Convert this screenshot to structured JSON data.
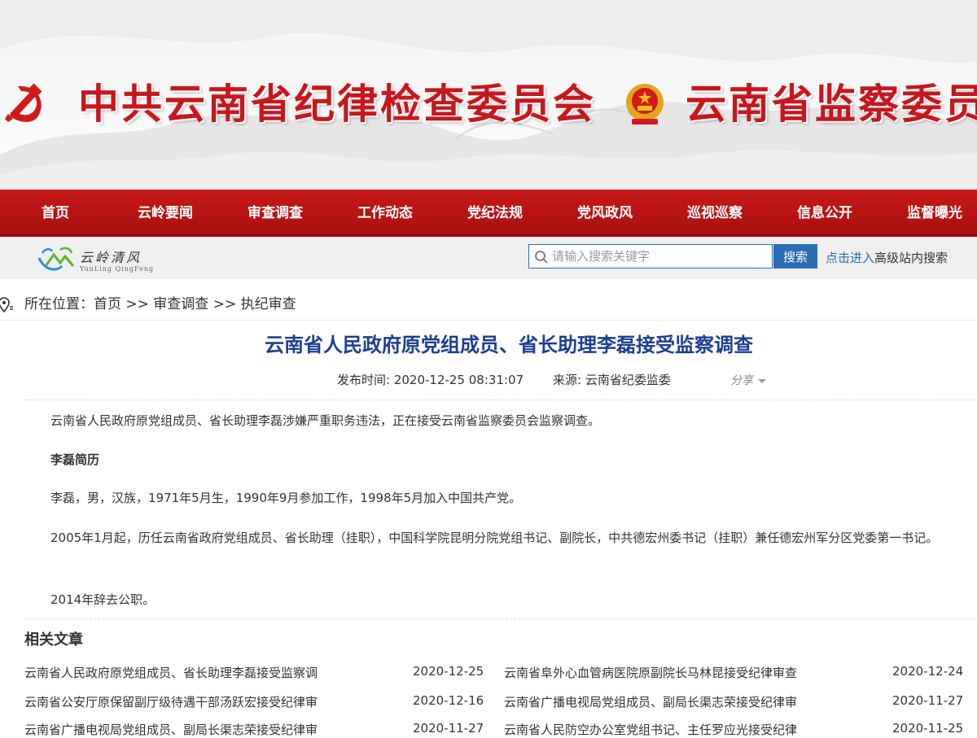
{
  "banner": {
    "title_left": "中共云南省纪律检查委员会",
    "title_right": "云南省监察委员会"
  },
  "nav": {
    "items": [
      {
        "label": "首页"
      },
      {
        "label": "云岭要闻"
      },
      {
        "label": "审查调查"
      },
      {
        "label": "工作动态"
      },
      {
        "label": "党纪法规"
      },
      {
        "label": "党风政风"
      },
      {
        "label": "巡视巡察"
      },
      {
        "label": "信息公开"
      },
      {
        "label": "监督曝光"
      }
    ]
  },
  "logo": {
    "script": "云岭清风",
    "pinyin": "YunLing QingFeng"
  },
  "search": {
    "placeholder": "请输入搜索关键字",
    "button_label": "搜索",
    "advanced_link": "点击进入",
    "advanced_text": "高级站内搜索"
  },
  "breadcrumb": {
    "prefix": "所在位置：",
    "items": [
      "首页",
      "审查调查",
      "执纪审查"
    ],
    "separator": " >> "
  },
  "article": {
    "title": "云南省人民政府原党组成员、省长助理李磊接受监察调查",
    "publish_time": "发布时间: 2020-12-25 08:31:07",
    "source": "来源: 云南省纪委监委",
    "share_label": "分享",
    "paragraphs": [
      "云南省人民政府原党组成员、省长助理李磊涉嫌严重职务违法，正在接受云南省监察委员会监察调查。",
      "李磊简历",
      "李磊，男，汉族，1971年5月生，1990年9月参加工作，1998年5月加入中国共产党。",
      "2005年1月起，历任云南省政府党组成员、省长助理（挂职），中国科学院昆明分院党组书记、副院长，中共德宏州委书记（挂职）兼任德宏州军分区党委第一书记。",
      "2014年辞去公职。"
    ]
  },
  "related": {
    "heading": "相关文章",
    "items": [
      {
        "title": "云南省人民政府原党组成员、省长助理李磊接受监察调",
        "date": "2020-12-25"
      },
      {
        "title": "云南省阜外心血管病医院原副院长马林昆接受纪律审查",
        "date": "2020-12-24"
      },
      {
        "title": "云南省公安厅原保留副厅级待遇干部汤跃宏接受纪律审",
        "date": "2020-12-16"
      },
      {
        "title": "云南省广播电视局党组成员、副局长渠志荣接受纪律审",
        "date": "2020-11-27"
      },
      {
        "title": "云南省广播电视局党组成员、副局长渠志荣接受纪律审",
        "date": "2020-11-27"
      },
      {
        "title": "云南省人民防空办公室党组书记、主任罗应光接受纪律",
        "date": "2020-11-25"
      }
    ]
  },
  "colors": {
    "nav_red": "#b31313",
    "title_blue": "#1d3f8f",
    "link_blue": "#2b6db5",
    "banner_red": "#c8161d"
  }
}
